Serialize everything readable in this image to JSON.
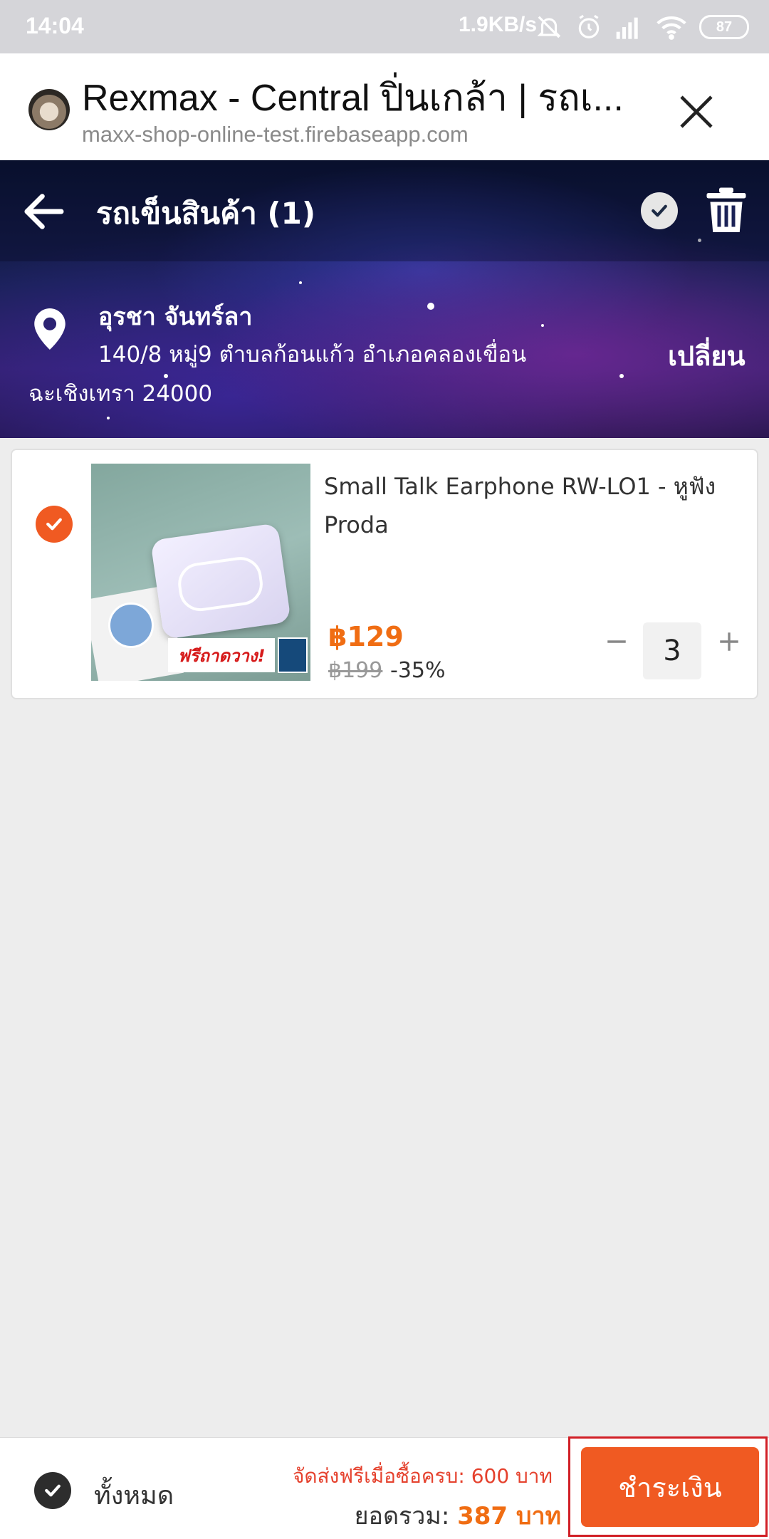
{
  "status_bar": {
    "time": "14:04",
    "network_speed": "1.9KB/s",
    "battery": "87",
    "icons": [
      "mute-icon",
      "alarm-icon",
      "signal-icon",
      "wifi-icon",
      "battery-icon"
    ]
  },
  "browser": {
    "title": "Rexmax - Central ปิ่นเกล้า | รถเ...",
    "url": "maxx-shop-online-test.firebaseapp.com",
    "close_icon": "close-icon"
  },
  "header": {
    "title": "รถเข็นสินค้า (1)",
    "back_icon": "arrow-left-icon",
    "check_icon": "check-circle-icon",
    "trash_icon": "trash-icon"
  },
  "address": {
    "name": "อุรชา จันทร์ลา",
    "line1": "140/8 หมู่9 ตำบลก้อนแก้ว อำเภอคลองเขื่อน",
    "line2": "ฉะเชิงเทรา 24000",
    "change_label": "เปลี่ยน"
  },
  "cart": {
    "items": [
      {
        "name": "Small Talk Earphone RW-LO1 - หูฟัง Proda",
        "price": "฿129",
        "original_price": "฿199",
        "discount": "-35%",
        "quantity": "3",
        "selected": true,
        "thumbnail_banner": "ฟรีถาดวาง!"
      }
    ]
  },
  "footer": {
    "select_all_label": "ทั้งหมด",
    "free_shipping_note": "จัดส่งฟรีเมื่อซื้อครบ: 600 บาท",
    "total_label": "ยอดรวม:",
    "total_value": "387 บาท",
    "checkout_label": "ชำระเงิน"
  },
  "colors": {
    "accent": "#f05a22",
    "price": "#f06d13",
    "free_shipping": "#e5412d",
    "highlight": "#d11f26"
  }
}
